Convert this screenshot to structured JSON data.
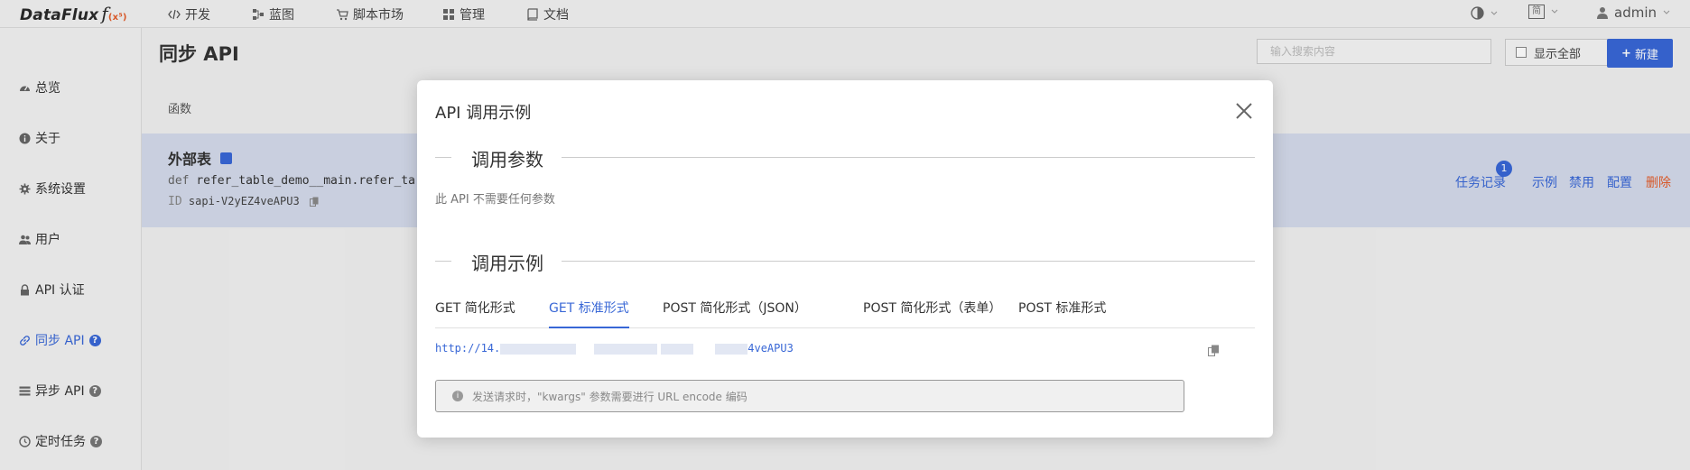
{
  "logo": {
    "text": "DataFlux",
    "fx": "f",
    "fx_sup": "(x⁵)"
  },
  "nav": [
    {
      "label": "开发",
      "icon": "code-icon"
    },
    {
      "label": "蓝图",
      "icon": "blueprint-icon"
    },
    {
      "label": "脚本市场",
      "icon": "cart-icon"
    },
    {
      "label": "管理",
      "icon": "grid-icon"
    },
    {
      "label": "文档",
      "icon": "book-icon"
    }
  ],
  "header_right": {
    "lang": "简",
    "user": "admin"
  },
  "sidebar": {
    "items": [
      {
        "label": "总览",
        "icon": "dashboard-icon"
      },
      {
        "label": "关于",
        "icon": "info-icon"
      },
      {
        "label": "系统设置",
        "icon": "gear-icon"
      },
      {
        "label": "用户",
        "icon": "users-icon"
      },
      {
        "label": "API 认证",
        "icon": "lock-icon"
      },
      {
        "label": "同步 API",
        "icon": "link-icon",
        "help": "?"
      },
      {
        "label": "异步 API",
        "icon": "list-icon",
        "help": "?"
      },
      {
        "label": "定时任务",
        "icon": "clock-icon",
        "help": "?"
      }
    ]
  },
  "page": {
    "title": "同步 API",
    "search_placeholder": "输入搜索内容",
    "show_all": "显示全部",
    "new_button": "新建",
    "column_function": "函数"
  },
  "row": {
    "title": "外部表",
    "def_kw": "def",
    "def_text": "refer_table_demo__main.refer_ta",
    "id_label": "ID",
    "id_value": "sapi-V2yEZ4veAPU3",
    "badge": "1",
    "actions": {
      "task_log": "任务记录",
      "example": "示例",
      "disable": "禁用",
      "config": "配置",
      "delete": "删除"
    }
  },
  "modal": {
    "title": "API 调用示例",
    "section_params": "调用参数",
    "no_params": "此 API 不需要任何参数",
    "section_examples": "调用示例",
    "tabs": [
      "GET 简化形式",
      "GET 标准形式",
      "POST 简化形式（JSON）",
      "POST 简化形式（表单）",
      "POST 标准形式"
    ],
    "active_tab": "GET 标准形式",
    "url_prefix": "http://14.",
    "url_suffix": "4veAPU3",
    "tip": "发送请求时，\"kwargs\" 参数需要进行 URL encode 编码"
  },
  "colors": {
    "accent": "#3867d6",
    "danger": "#e35d2b"
  }
}
